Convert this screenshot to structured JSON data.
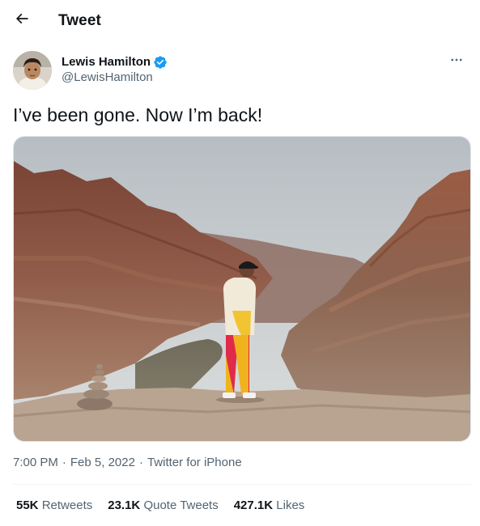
{
  "header": {
    "back_icon": "arrow-left-icon",
    "title": "Tweet"
  },
  "author": {
    "name": "Lewis Hamilton",
    "handle": "@LewisHamilton",
    "verified_icon": "verified-badge-icon",
    "verified_color": "#1d9bf0",
    "more_icon": "more-horizontal-icon"
  },
  "tweet": {
    "text": "I’ve been gone. Now I’m back!"
  },
  "meta": {
    "time": "7:00 PM",
    "separator": "·",
    "date": "Feb 5, 2022",
    "source": "Twitter for iPhone"
  },
  "stats": [
    {
      "value": "55K",
      "label": "Retweets"
    },
    {
      "value": "23.1K",
      "label": "Quote Tweets"
    },
    {
      "value": "427.1K",
      "label": "Likes"
    }
  ]
}
